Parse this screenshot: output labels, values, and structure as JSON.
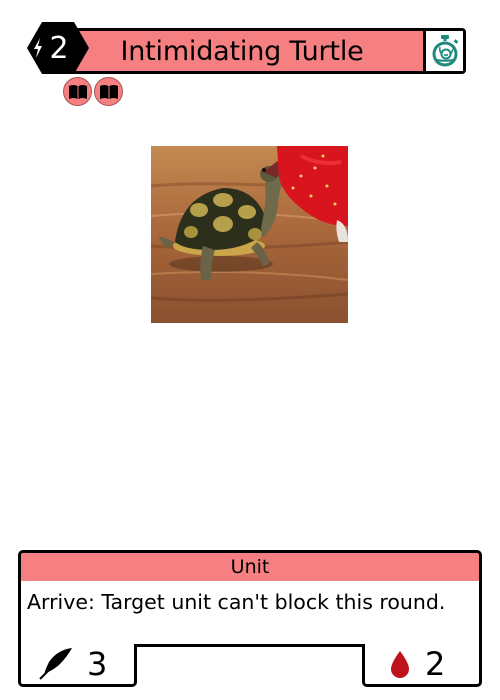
{
  "card": {
    "cost": "2",
    "name": "Intimidating Turtle",
    "type": "Unit",
    "ability_text": "Arrive: Target unit can't block this round.",
    "power": "3",
    "health": "2",
    "speed_icon": "snail-stopwatch-icon",
    "tags": [
      "book-icon",
      "book-icon"
    ],
    "colors": {
      "accent": "#f57f81",
      "cost_bg": "#000000",
      "speed_icon": "#1e8a7e",
      "health_icon": "#c0121a",
      "border": "#000000"
    }
  }
}
